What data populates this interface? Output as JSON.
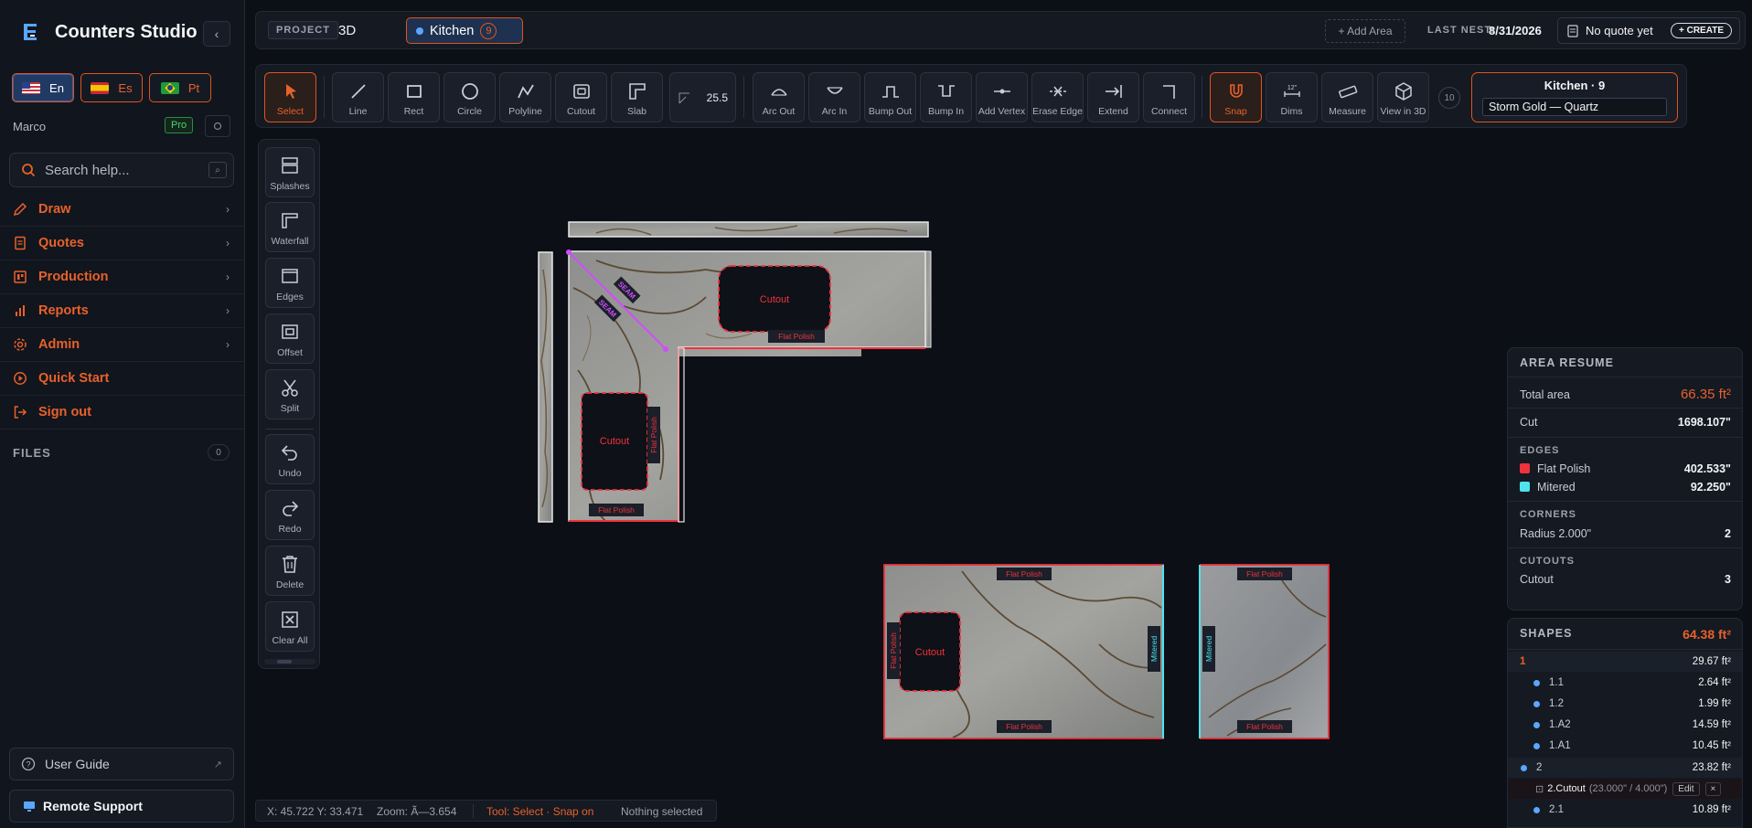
{
  "brand": {
    "name": "Counters Studio"
  },
  "sidebar": {
    "collapse_icon": "‹",
    "languages": [
      {
        "code": "En",
        "flag": "us",
        "active": true
      },
      {
        "code": "Es",
        "flag": "es",
        "active": false
      },
      {
        "code": "Pt",
        "flag": "br",
        "active": false
      }
    ],
    "user_name": "Marco",
    "plan_badge": "Pro",
    "search_placeholder": "Search help...",
    "nav": [
      {
        "label": "Draw",
        "icon": "pencil-icon"
      },
      {
        "label": "Quotes",
        "icon": "document-icon"
      },
      {
        "label": "Production",
        "icon": "production-icon"
      },
      {
        "label": "Reports",
        "icon": "bar-chart-icon"
      },
      {
        "label": "Admin",
        "icon": "gear-icon"
      },
      {
        "label": "Quick Start",
        "icon": "play-circle-icon"
      },
      {
        "label": "Sign out",
        "icon": "sign-out-icon"
      }
    ],
    "files_label": "FILES",
    "files_count": "0",
    "user_guide": "User Guide",
    "remote_support": "Remote Support"
  },
  "topbar": {
    "project_label": "PROJECT",
    "project_name": "3D",
    "area_name": "Kitchen",
    "area_count": "9",
    "add_area": "+ Add Area",
    "last_nest_label": "LAST NEST:",
    "last_nest_date": "8/31/2026",
    "quote_status": "No quote yet",
    "create_label": "+ CREATE"
  },
  "toolbar": {
    "tools_a": [
      {
        "label": "Select",
        "icon": "cursor-icon",
        "active": true
      }
    ],
    "tools_b": [
      {
        "label": "Line",
        "icon": "line-icon"
      },
      {
        "label": "Rect",
        "icon": "rectangle-icon"
      },
      {
        "label": "Circle",
        "icon": "circle-icon"
      },
      {
        "label": "Polyline",
        "icon": "polyline-icon"
      },
      {
        "label": "Cutout",
        "icon": "cutout-icon"
      },
      {
        "label": "Slab",
        "icon": "slab-icon"
      }
    ],
    "corner_value": "25.5",
    "tools_c": [
      {
        "label": "Arc Out",
        "icon": "arc-out-icon"
      },
      {
        "label": "Arc In",
        "icon": "arc-in-icon"
      },
      {
        "label": "Bump Out",
        "icon": "bump-out-icon"
      },
      {
        "label": "Bump In",
        "icon": "bump-in-icon"
      },
      {
        "label": "Add Vertex",
        "icon": "add-vertex-icon"
      },
      {
        "label": "Erase Edge",
        "icon": "erase-edge-icon"
      },
      {
        "label": "Extend",
        "icon": "extend-icon"
      },
      {
        "label": "Connect",
        "icon": "connect-icon"
      }
    ],
    "tools_d": [
      {
        "label": "Snap",
        "icon": "magnet-icon",
        "active": true
      },
      {
        "label": "Dims",
        "icon": "dimensions-icon"
      },
      {
        "label": "Measure",
        "icon": "ruler-icon"
      },
      {
        "label": "View in 3D",
        "icon": "cube-icon"
      }
    ],
    "dims_icon_text": "12\"",
    "count": "10",
    "area_title": "Kitchen · 9",
    "material": "Storm Gold — Quartz"
  },
  "side_tools": [
    {
      "label": "Splashes",
      "icon": "splash-icon"
    },
    {
      "label": "Waterfall",
      "icon": "waterfall-icon"
    },
    {
      "label": "Edges",
      "icon": "edges-icon"
    },
    {
      "label": "Offset",
      "icon": "offset-icon"
    },
    {
      "label": "Split",
      "icon": "scissors-icon"
    },
    {
      "label": "Undo",
      "icon": "undo-icon"
    },
    {
      "label": "Redo",
      "icon": "redo-icon"
    },
    {
      "label": "Delete",
      "icon": "trash-icon"
    },
    {
      "label": "Clear All",
      "icon": "clear-all-icon"
    }
  ],
  "canvas": {
    "cutout_label": "Cutout",
    "flat_polish_label": "Flat Polish",
    "mitered_label": "Mitered",
    "seam_label": "SEAM"
  },
  "resume": {
    "title": "AREA RESUME",
    "total_area_label": "Total area",
    "total_area_value": "66.35 ft²",
    "cut_label": "Cut",
    "cut_value": "1698.107\"",
    "edges_label": "EDGES",
    "edges": [
      {
        "name": "Flat Polish",
        "value": "402.533\"",
        "color": "#f0323c"
      },
      {
        "name": "Mitered",
        "value": "92.250\"",
        "color": "#4fe3f0"
      }
    ],
    "corners_label": "CORNERS",
    "corner_name": "Radius 2.000\"",
    "corner_value": "2",
    "cutouts_label": "CUTOUTS",
    "cutout_name": "Cutout",
    "cutout_value": "3"
  },
  "shapes": {
    "title": "SHAPES",
    "total": "64.38 ft²",
    "rows": [
      {
        "id": "1",
        "value": "29.67 ft²",
        "level": 0
      },
      {
        "id": "1.1",
        "value": "2.64 ft²",
        "level": 1
      },
      {
        "id": "1.2",
        "value": "1.99 ft²",
        "level": 1
      },
      {
        "id": "1.A2",
        "value": "14.59 ft²",
        "level": 1
      },
      {
        "id": "1.A1",
        "value": "10.45 ft²",
        "level": 1
      },
      {
        "id": "2",
        "value": "23.82 ft²",
        "level": 0
      }
    ],
    "cutout_row": {
      "name": "2.Cutout",
      "dims": "(23.000\" / 4.000\")",
      "edit": "Edit",
      "remove": "×"
    },
    "last_row": {
      "id": "2.1",
      "value": "10.89 ft²"
    }
  },
  "status": {
    "coords": "X: 45.722 Y: 33.471",
    "zoom": "Zoom: Ã—3.654",
    "tool": "Tool: Select · Snap on",
    "selection": "Nothing selected"
  },
  "colors": {
    "accent": "#e8612a",
    "flat_polish": "#f0323c",
    "mitered": "#4fe3f0",
    "seam": "#d04cff"
  }
}
